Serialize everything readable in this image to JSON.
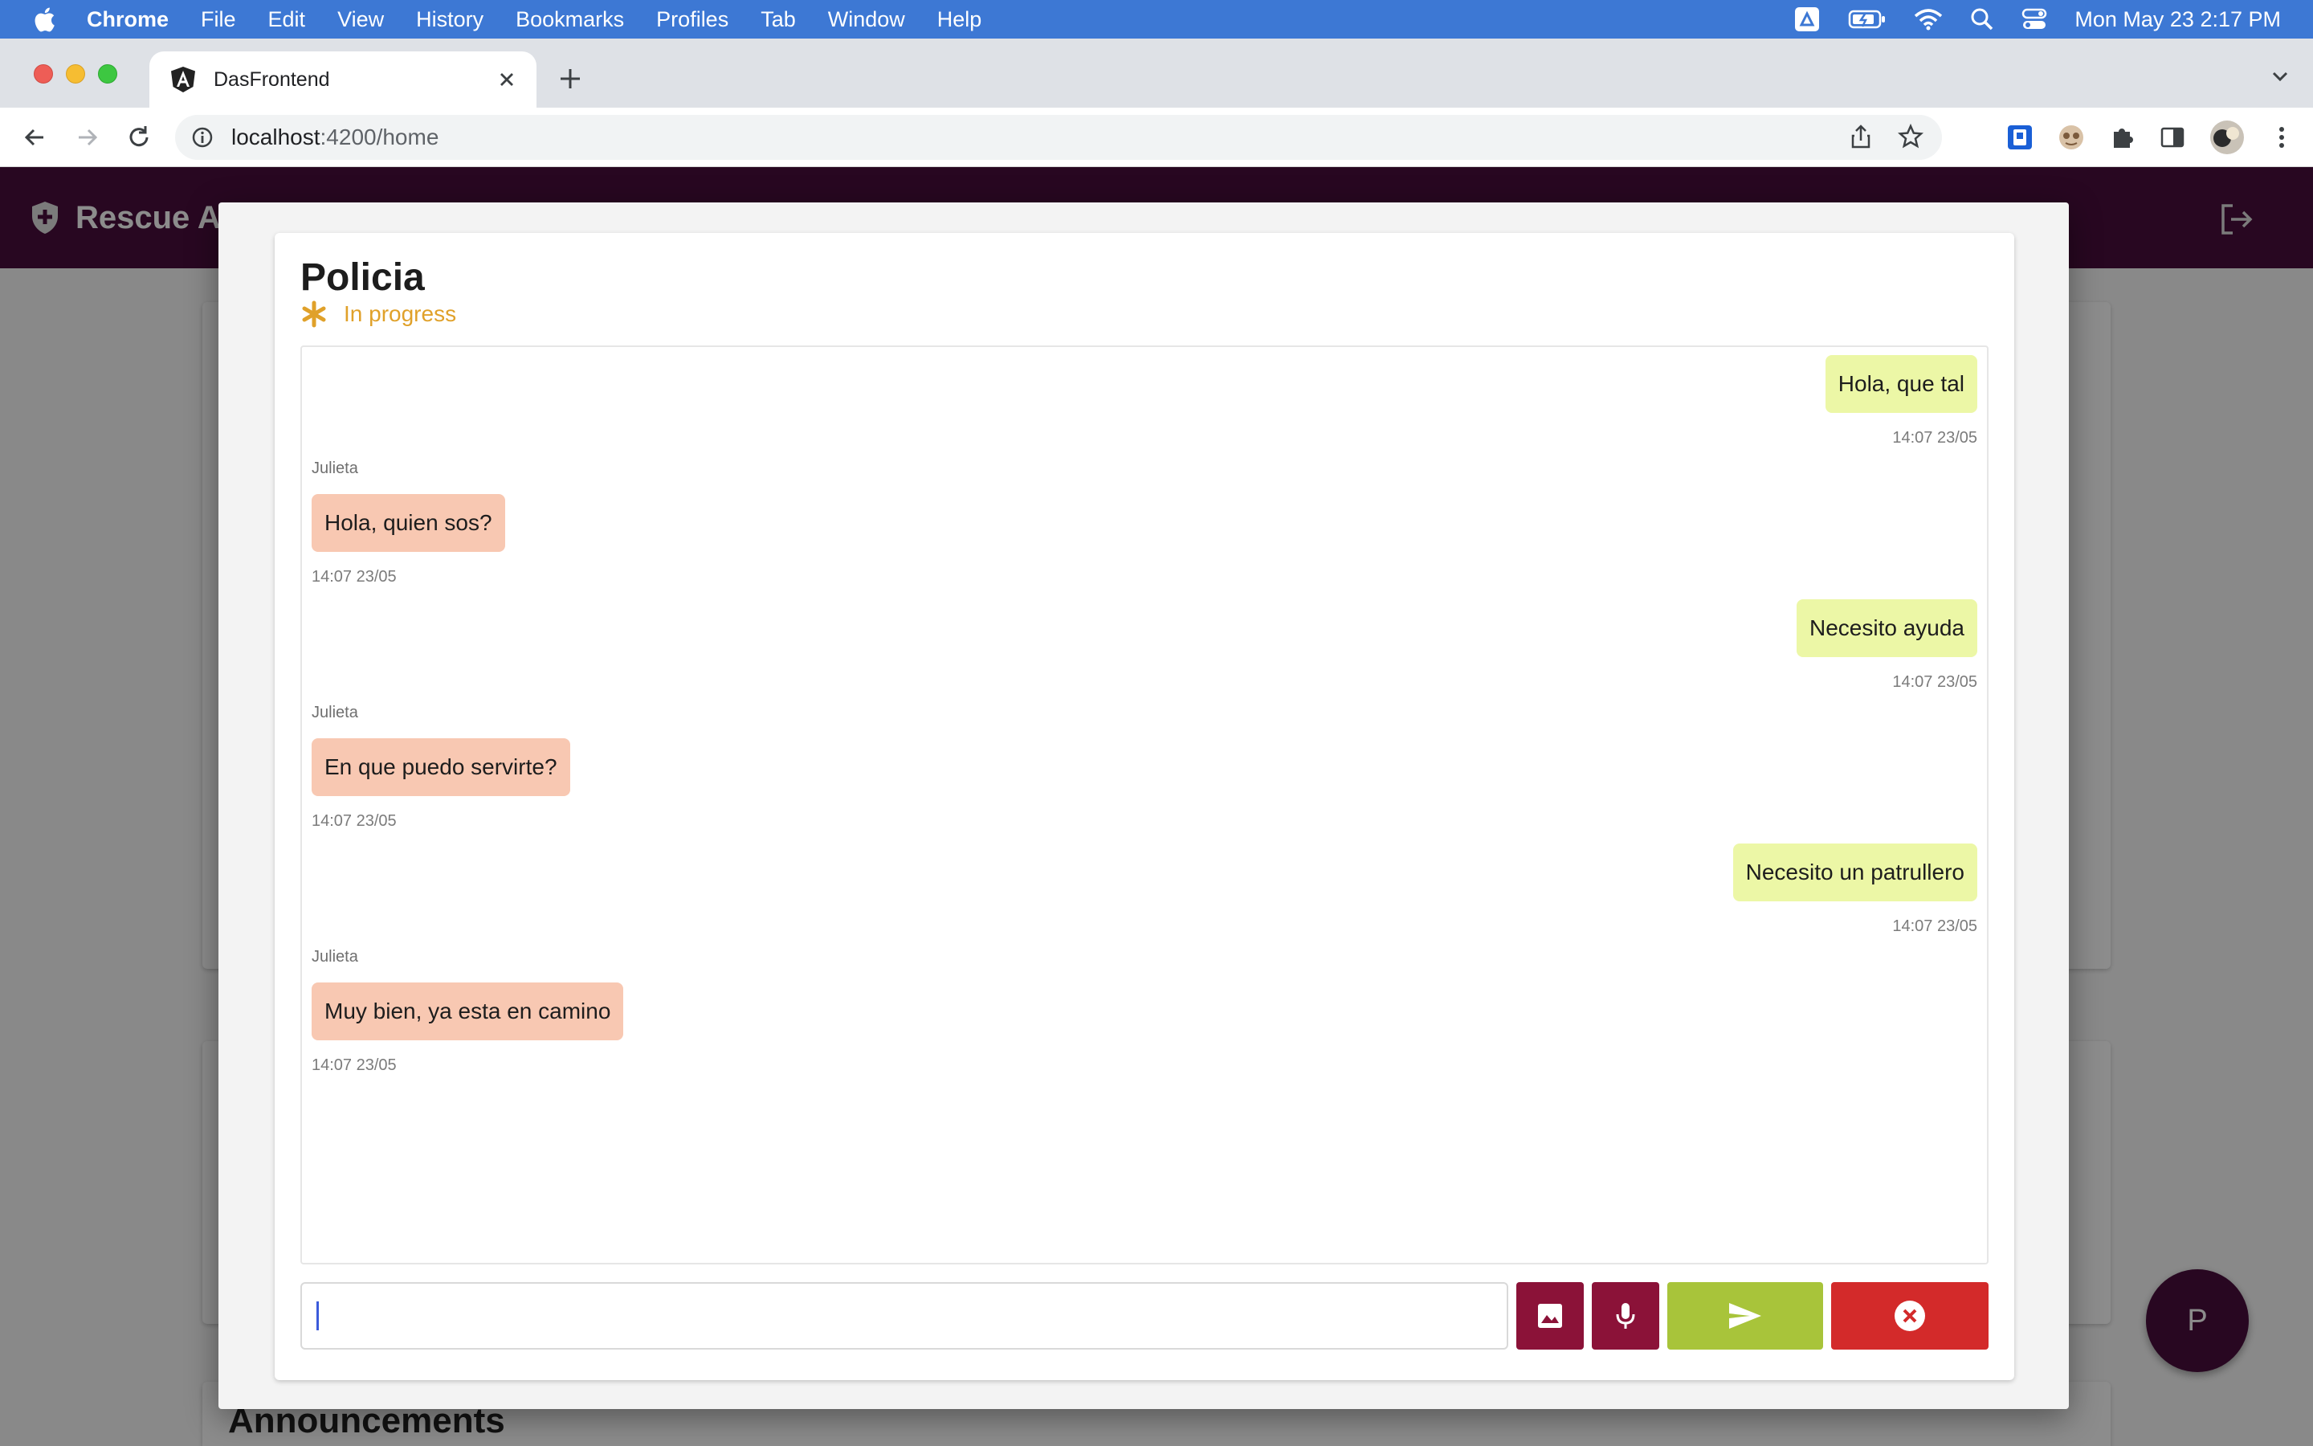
{
  "menubar": {
    "app": "Chrome",
    "items": [
      "File",
      "Edit",
      "View",
      "History",
      "Bookmarks",
      "Profiles",
      "Tab",
      "Window",
      "Help"
    ],
    "clock": "Mon May 23  2:17 PM"
  },
  "browser": {
    "tab_title": "DasFrontend",
    "url_host": "localhost",
    "url_path": ":4200/home"
  },
  "app": {
    "brand": "Rescue Ap",
    "announcements": "Announcements",
    "avatar_letter": "P"
  },
  "chat": {
    "title": "Policia",
    "status": "In progress",
    "status_color": "#e0a12a",
    "input_value": "",
    "messages": [
      {
        "direction": "out",
        "text": "Hola, que tal",
        "time": "14:07 23/05"
      },
      {
        "direction": "in",
        "sender": "Julieta",
        "text": "Hola, quien sos?",
        "time": "14:07 23/05"
      },
      {
        "direction": "out",
        "text": "Necesito ayuda",
        "time": "14:07 23/05"
      },
      {
        "direction": "in",
        "sender": "Julieta",
        "text": "En que puedo servirte?",
        "time": "14:07 23/05"
      },
      {
        "direction": "out",
        "text": "Necesito un patrullero",
        "time": "14:07 23/05"
      },
      {
        "direction": "in",
        "sender": "Julieta",
        "text": "Muy bien, ya esta en camino",
        "time": "14:07 23/05"
      }
    ],
    "buttons": [
      "image-icon",
      "microphone-icon",
      "send-icon",
      "close-circle-icon"
    ]
  },
  "colors": {
    "app_primary": "#4a0d3c",
    "outgoing_bubble": "#ecf7a6",
    "incoming_bubble": "#f8c8b2",
    "media_button": "#8b1238",
    "send_button": "#a8c43a",
    "close_button": "#d32a2a"
  }
}
